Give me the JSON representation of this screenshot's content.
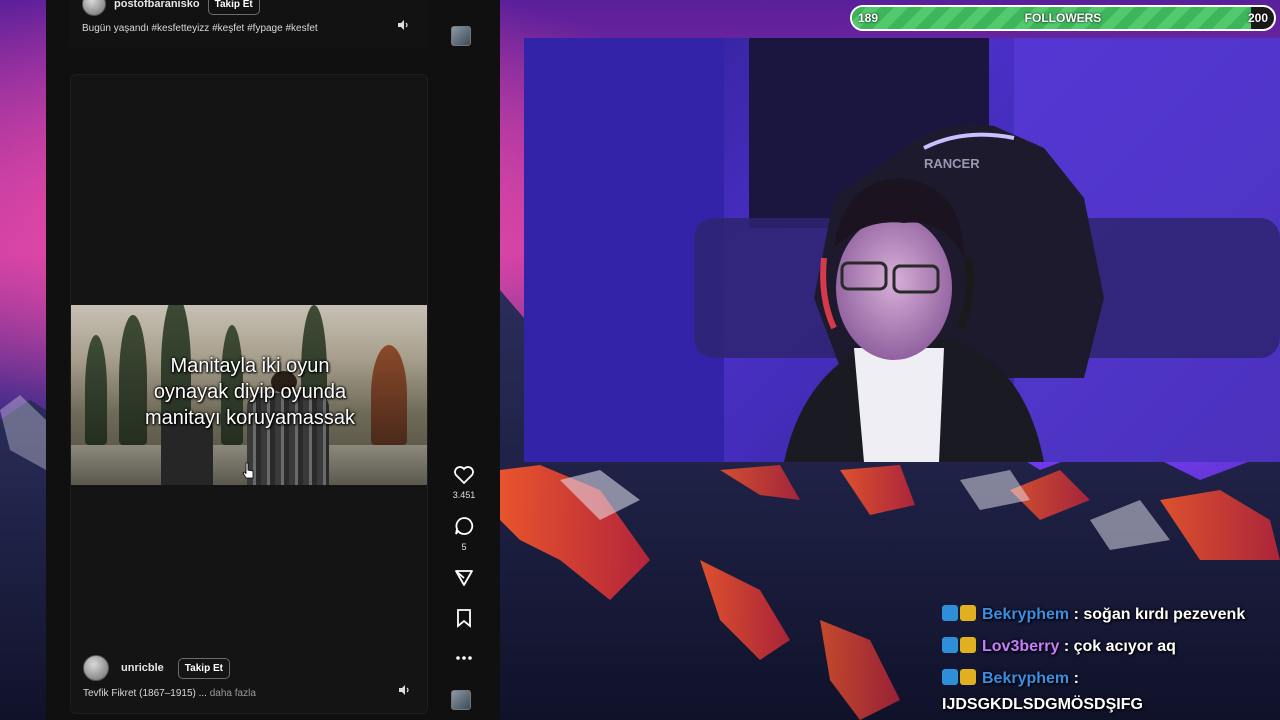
{
  "top_post": {
    "author": "postofbaranisko",
    "follow_label": "Takip Et",
    "caption": "Bugün yaşandı #kesfetteyizz #keşfet #fypage #kesfet"
  },
  "video": {
    "overlay_text": "Manitayla iki oyun\noynayak diyip oyunda\nmanitayı koruyamassak"
  },
  "actions": {
    "likes": "3.451",
    "comments": "5"
  },
  "bottom_post": {
    "author": "unricble",
    "follow_label": "Takip Et",
    "caption": "Tevfik Fikret (1867–1915) ...",
    "more_label": "daha fazla"
  },
  "followers": {
    "label": "FOLLOWERS",
    "current": "189",
    "goal": "200",
    "progress": 0.945
  },
  "webcam": {
    "chair_brand": "RANCER"
  },
  "chat": [
    {
      "user": "Bekryphem",
      "user_color": "#3a8ee6",
      "sep": ":",
      "message": "soğan kırdı pezevenk"
    },
    {
      "user": "Lov3berry",
      "user_color": "#c77dff",
      "sep": ":",
      "message": "çok acıyor aq"
    },
    {
      "user": "Bekryphem",
      "user_color": "#3a8ee6",
      "sep": ":",
      "message": "IJDSGKDLSDGMÖSDŞIFG"
    }
  ],
  "colors": {
    "feed_bg": "#101010",
    "followers_fill": "#3db55a",
    "accent_purple": "#5a2fd0"
  }
}
